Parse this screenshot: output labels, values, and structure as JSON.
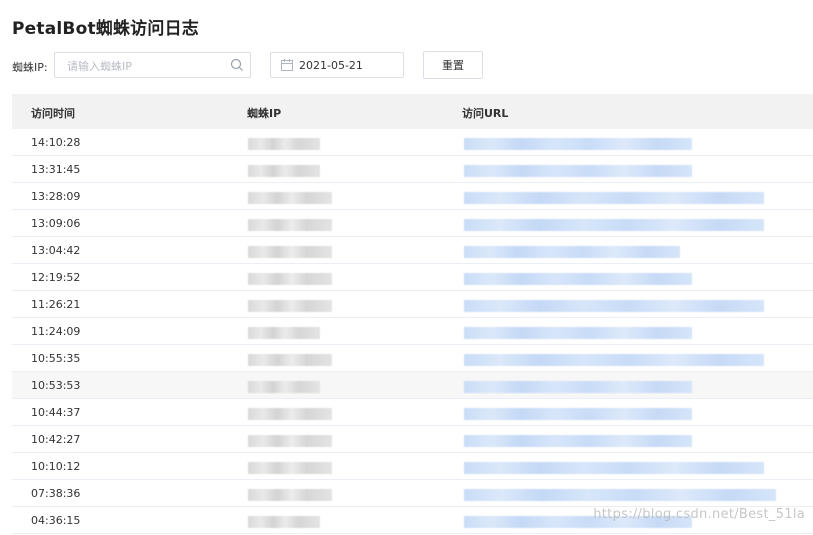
{
  "page": {
    "title": "PetalBot蜘蛛访问日志"
  },
  "filter": {
    "ip_label": "蜘蛛IP:",
    "ip_placeholder": "请输入蜘蛛IP",
    "ip_value": "",
    "date_value": "2021-05-21",
    "reset_label": "重置"
  },
  "table": {
    "columns": [
      "访问时间",
      "蜘蛛IP",
      "访问URL"
    ],
    "rows": [
      {
        "time": "14:10:28"
      },
      {
        "time": "13:31:45"
      },
      {
        "time": "13:28:09"
      },
      {
        "time": "13:09:06"
      },
      {
        "time": "13:04:42"
      },
      {
        "time": "12:19:52"
      },
      {
        "time": "11:26:21"
      },
      {
        "time": "11:24:09"
      },
      {
        "time": "10:55:35"
      },
      {
        "time": "10:53:53"
      },
      {
        "time": "10:44:37"
      },
      {
        "time": "10:42:27"
      },
      {
        "time": "10:10:12"
      },
      {
        "time": "07:38:36"
      },
      {
        "time": "04:36:15"
      }
    ]
  },
  "watermark": "https://blog.csdn.net/Best_51la",
  "colors": {
    "header_bg": "#f2f2f2",
    "url_blur": "#c9ddf7",
    "ip_blur": "#d9d9d9"
  }
}
